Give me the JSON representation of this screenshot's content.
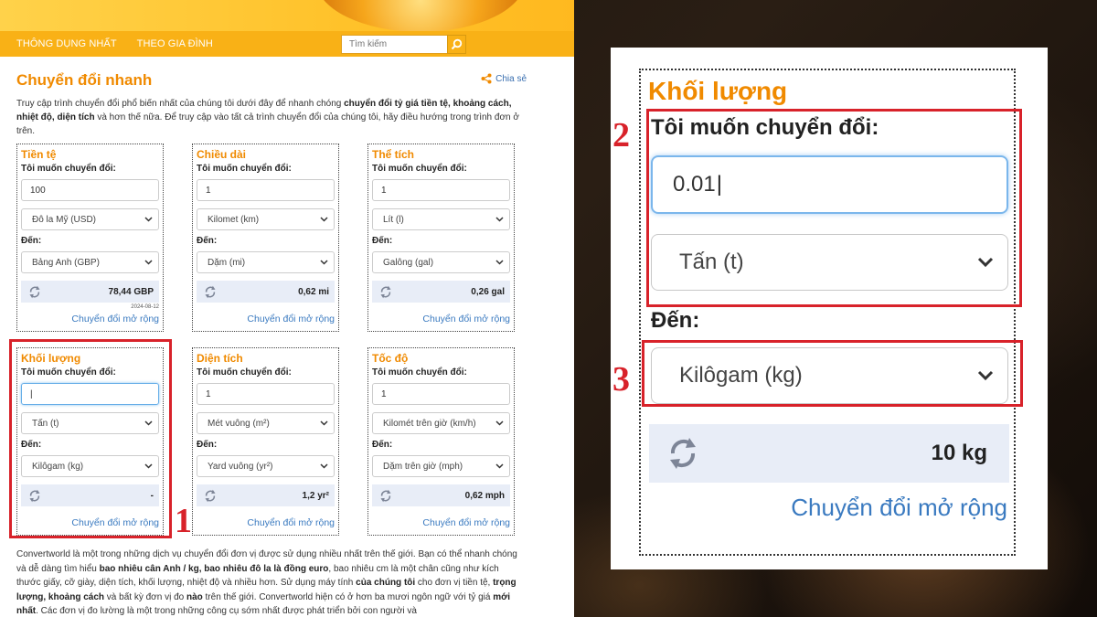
{
  "nav": {
    "links": [
      "THÔNG DỤNG NHẤT",
      "THEO GIA ĐÌNH"
    ],
    "search_placeholder": "Tìm kiếm"
  },
  "page": {
    "title": "Chuyển đổi nhanh",
    "share_label": "Chia sẻ",
    "intro": {
      "p1": "Truy cập trình chuyển đổi phổ biến nhất của chúng tôi dưới đây để nhanh chóng ",
      "b1": "chuyển đổi tỷ giá tiền tệ, khoảng cách, nhiệt độ, diện tích",
      "p2": " và hơn thế nữa. Để truy cập vào tất cả trình chuyển đổi của chúng tôi, hãy điều hướng trong trình đơn ở trên."
    }
  },
  "cards": [
    {
      "title": "Tiền tệ",
      "label": "Tôi muốn chuyển đổi:",
      "input": "100",
      "from": "Đô la Mỹ (USD)",
      "to_label": "Đến:",
      "to": "Bảng Anh (GBP)",
      "result": "78,44 GBP",
      "date": "2024-08-12",
      "link": "Chuyển đổi mở rộng"
    },
    {
      "title": "Chiều dài",
      "label": "Tôi muốn chuyển đổi:",
      "input": "1",
      "from": "Kilomet (km)",
      "to_label": "Đến:",
      "to": "Dặm (mi)",
      "result": "0,62 mi",
      "date": "",
      "link": "Chuyển đổi mở rộng"
    },
    {
      "title": "Thể tích",
      "label": "Tôi muốn chuyển đổi:",
      "input": "1",
      "from": "Lít (l)",
      "to_label": "Đến:",
      "to": "Galông (gal)",
      "result": "0,26 gal",
      "date": "",
      "link": "Chuyển đổi mở rộng"
    },
    {
      "title": "Khối lượng",
      "label": "Tôi muốn chuyển đổi:",
      "input": "|",
      "from": "Tấn (t)",
      "to_label": "Đến:",
      "to": "Kilôgam (kg)",
      "result": "-",
      "date": "",
      "link": "Chuyển đổi mở rộng"
    },
    {
      "title": "Diện tích",
      "label": "Tôi muốn chuyển đổi:",
      "input": "1",
      "from": "Mét vuông (m²)",
      "to_label": "Đến:",
      "to": "Yard vuông (yr²)",
      "result": "1,2 yr²",
      "date": "",
      "link": "Chuyển đổi mở rộng"
    },
    {
      "title": "Tốc độ",
      "label": "Tôi muốn chuyển đổi:",
      "input": "1",
      "from": "Kilomét trên giờ (km/h)",
      "to_label": "Đến:",
      "to": "Dặm trên giờ (mph)",
      "result": "0,62 mph",
      "date": "",
      "link": "Chuyển đổi mở rộng"
    }
  ],
  "footer": {
    "t1": "Convertworld là một trong những dịch vụ chuyển đổi đơn vị được sử dụng nhiều nhất trên thế giới. Bạn có thể nhanh chóng và dễ dàng tìm hiểu ",
    "b1": "bao nhiêu cân Anh / kg, bao nhiêu đô la là đồng euro",
    "t2": ", bao nhiêu cm là một chân cũng như kích thước giấy, cỡ giày, diện tích, khối lượng, nhiệt độ và nhiều hơn. Sử dụng máy tính ",
    "b2": "của chúng tôi",
    "t3": " cho đơn vị tiền tệ, ",
    "b3": "trọng lượng, khoảng cách",
    "t4": " và bất kỳ đơn vị đo ",
    "b4": "nào",
    "t5": " trên thế giới. Convertworld hiện có ở hơn ba mươi ngôn ngữ với tỷ giá ",
    "b5": "mới nhất",
    "t6": ". Các đơn vị đo lường là một trong những công cụ sớm nhất được phát triển bởi con người và"
  },
  "zoom": {
    "title": "Khối lượng",
    "label": "Tôi muốn chuyển đổi:",
    "input": "0.01",
    "from": "Tấn (t)",
    "to_label": "Đến:",
    "to": "Kilôgam (kg)",
    "result": "10 kg",
    "link": "Chuyển đổi mở rộng"
  },
  "annotations": [
    "1",
    "2",
    "3"
  ],
  "colors": {
    "accent": "#f08a00",
    "nav": "#f9b116",
    "highlight": "#d8222a",
    "link": "#3a7ac0"
  }
}
